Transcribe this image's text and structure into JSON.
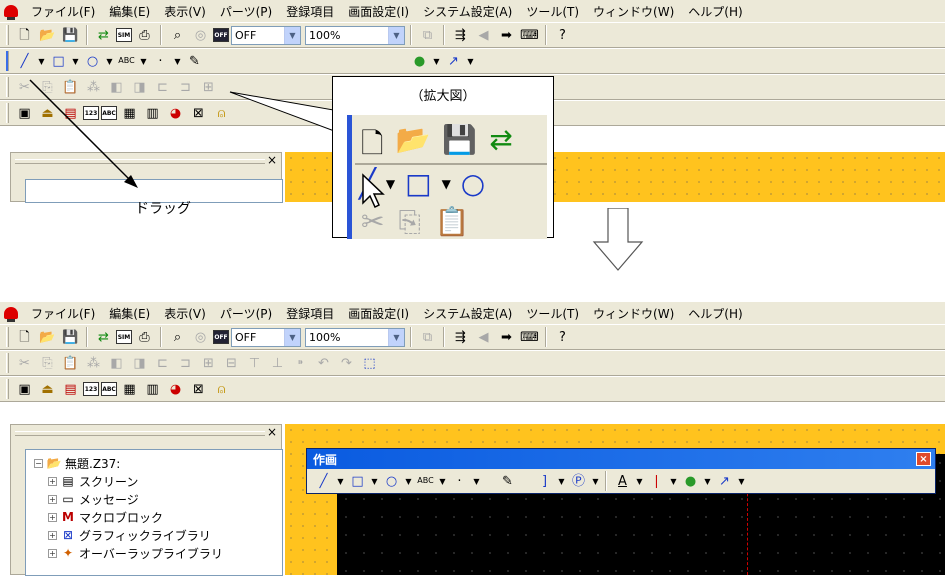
{
  "menu": {
    "items": [
      "ファイル(F)",
      "編集(E)",
      "表示(V)",
      "パーツ(P)",
      "登録項目",
      "画面設定(I)",
      "システム設定(A)",
      "ツール(T)",
      "ウィンドウ(W)",
      "ヘルプ(H)"
    ]
  },
  "toolbar": {
    "off_combo_value": "OFF",
    "zoom_combo_value": "100%",
    "off_icon_text": "OFF",
    "sim_icon_text": "SIM"
  },
  "drawing_toolbar": {
    "text_tool_label": "ABC",
    "text_color_label": "A"
  },
  "callout": {
    "label": "（拡大図）"
  },
  "drag_label": "ドラッグ",
  "float_window": {
    "title": "作画",
    "close": "×"
  },
  "tree": {
    "root_label": "無題.Z37:",
    "items": [
      {
        "label": "スクリーン",
        "icon": "screen-icon"
      },
      {
        "label": "メッセージ",
        "icon": "message-icon"
      },
      {
        "label": "マクロブロック",
        "icon": "macro-block-icon"
      },
      {
        "label": "グラフィックライブラリ",
        "icon": "graphic-library-icon"
      },
      {
        "label": "オーバーラップライブラリ",
        "icon": "overlap-library-icon"
      }
    ]
  },
  "panel": {
    "close": "×"
  },
  "colors": {
    "canvas_bg": "#ffc31e",
    "title_bar": "#0a5be0",
    "dashed_guide": "#d00000"
  }
}
